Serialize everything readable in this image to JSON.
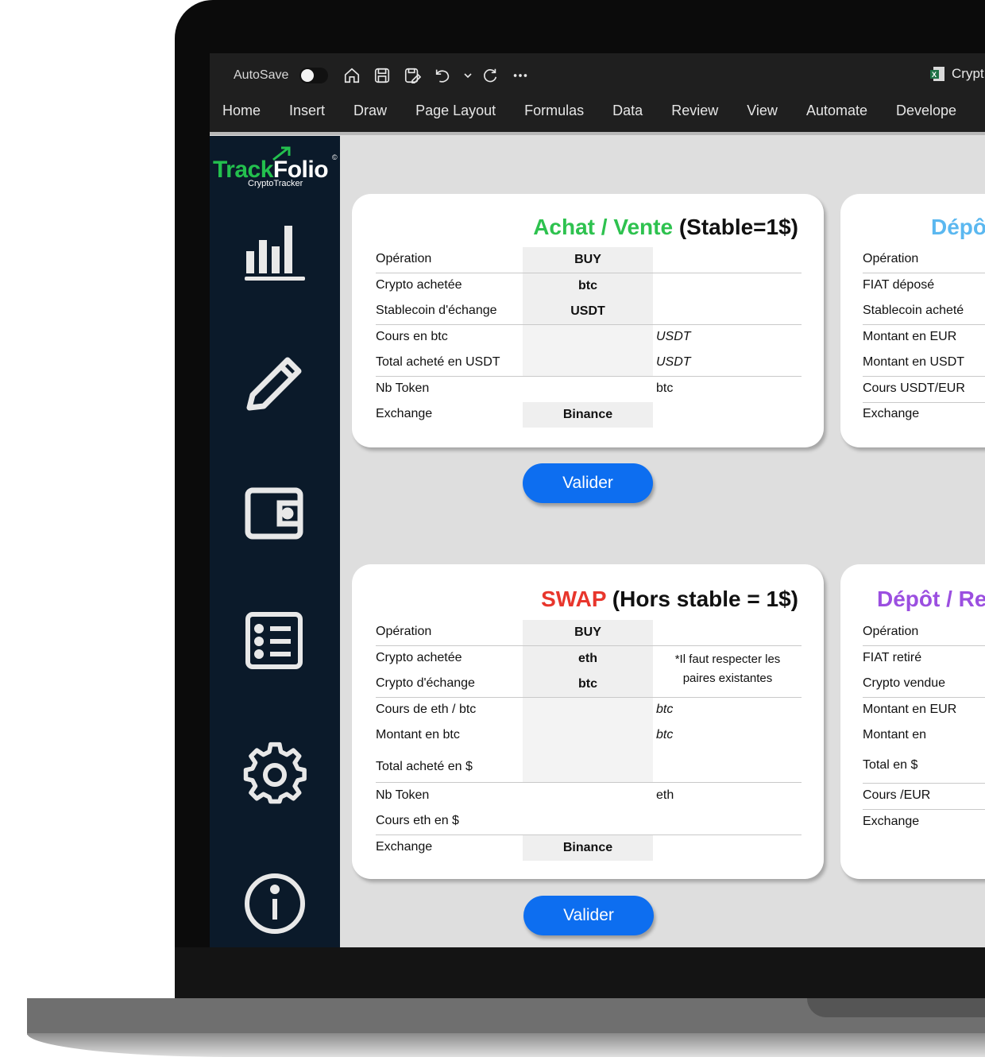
{
  "toolbar": {
    "autosave": "AutoSave",
    "file_title": "Crypt",
    "icons": [
      "home-icon",
      "save-icon",
      "save-as-icon",
      "undo-icon",
      "dropdown-icon",
      "redo-icon",
      "more-icon"
    ]
  },
  "ribbon": {
    "tabs": [
      "Home",
      "Insert",
      "Draw",
      "Page Layout",
      "Formulas",
      "Data",
      "Review",
      "View",
      "Automate",
      "Develope"
    ]
  },
  "sidebar": {
    "logo_track": "Track",
    "logo_folio": "Folio",
    "logo_copyright": "©",
    "logo_subtitle": "CryptoTracker",
    "icons": [
      "bar-chart-icon",
      "pencil-icon",
      "wallet-icon",
      "list-icon",
      "gear-icon",
      "info-icon"
    ]
  },
  "achat": {
    "title_colored": "Achat / Vente",
    "title_rest": " (Stable=1$)",
    "title_color": "#2ec24f",
    "rows": [
      {
        "label": "Opération",
        "value": "BUY",
        "unit": ""
      },
      {
        "label": "Crypto achetée",
        "value": "btc",
        "unit": ""
      },
      {
        "label": "Stablecoin d'échange",
        "value": "USDT",
        "unit": ""
      },
      {
        "label": "Cours en btc",
        "value": "",
        "unit": "USDT"
      },
      {
        "label": "Total acheté en USDT",
        "value": "",
        "unit": "USDT"
      },
      {
        "label": "Nb Token",
        "value": "",
        "unit": "btc"
      },
      {
        "label": "Exchange",
        "value": "Binance",
        "unit": ""
      }
    ],
    "button": "Valider"
  },
  "depot_top": {
    "title": "Dépô",
    "title_color": "#5bb8f0",
    "rows": [
      "Opération",
      "FIAT déposé",
      "Stablecoin acheté",
      "Montant en EUR",
      "Montant en USDT",
      "Cours  USDT/EUR",
      "Exchange"
    ]
  },
  "swap": {
    "title_colored": "SWAP",
    "title_rest": " (Hors stable = 1$)",
    "title_color": "#e8362c",
    "rows": [
      {
        "label": "Opération",
        "value": "BUY",
        "unit": ""
      },
      {
        "label": "Crypto achetée",
        "value": "eth",
        "unit": ""
      },
      {
        "label": "Crypto d'échange",
        "value": "btc",
        "unit": ""
      },
      {
        "label": "Cours de eth / btc",
        "value": "",
        "unit": "btc"
      },
      {
        "label": "Montant en btc",
        "value": "",
        "unit": "btc"
      },
      {
        "label": "Total acheté en $",
        "value": "",
        "unit": ""
      },
      {
        "label": "Nb Token",
        "value": "",
        "unit": "eth"
      },
      {
        "label": "Cours eth en $",
        "value": "",
        "unit": ""
      },
      {
        "label": "Exchange",
        "value": "Binance",
        "unit": ""
      }
    ],
    "note_line1": "*Il faut respecter les",
    "note_line2": "paires existantes",
    "button": "Valider"
  },
  "depot_bottom": {
    "title": "Dépôt / Re",
    "title_color": "#9b4fe0",
    "rows": [
      "Opération",
      "FIAT retiré",
      "Crypto vendue",
      "Montant en EUR",
      "Montant en",
      "Total en $",
      "Cours  /EUR",
      "Exchange"
    ]
  }
}
